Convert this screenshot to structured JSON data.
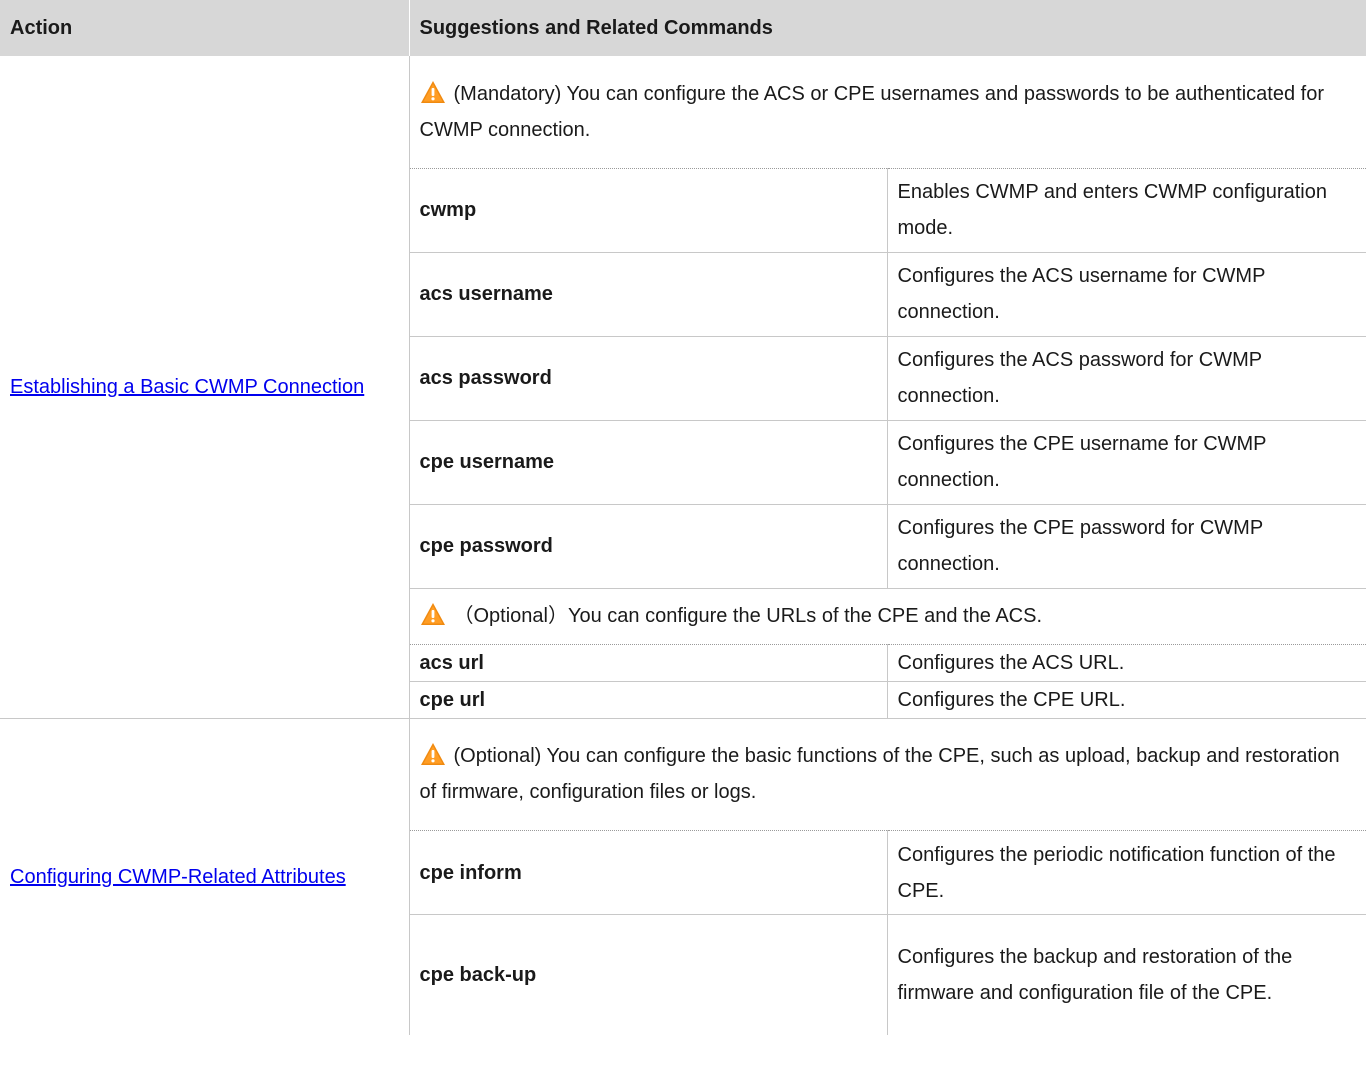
{
  "header": {
    "action": "Action",
    "suggestions": "Suggestions and Related Commands"
  },
  "sections": [
    {
      "action": "Establishing a Basic CWMP Connection",
      "groups": [
        {
          "note": "(Mandatory) You can configure the ACS or CPE usernames and passwords to be authenticated for CWMP connection.",
          "commands": [
            {
              "command": "cwmp",
              "description": "Enables CWMP and enters CWMP configuration mode."
            },
            {
              "command": "acs username",
              "description": "Configures the ACS username for CWMP connection."
            },
            {
              "command": "acs password",
              "description": "Configures the ACS password for CWMP connection."
            },
            {
              "command": "cpe username",
              "description": "Configures the CPE username for CWMP connection."
            },
            {
              "command": "cpe password",
              "description": "Configures the CPE password for CWMP connection."
            }
          ]
        },
        {
          "note": "（Optional）You can configure the URLs of the CPE and the ACS.",
          "commands": [
            {
              "command": "acs url",
              "description": "Configures the ACS URL."
            },
            {
              "command": "cpe url",
              "description": "Configures the CPE URL."
            }
          ]
        }
      ]
    },
    {
      "action": "Configuring CWMP-Related Attributes",
      "groups": [
        {
          "note": "(Optional) You can configure the basic functions of the CPE, such as upload, backup and restoration of firmware, configuration files or logs.",
          "commands": [
            {
              "command": "cpe inform",
              "description": "Configures the periodic notification function of the CPE."
            },
            {
              "command": "cpe back-up",
              "description": "Configures the backup and restoration of the firmware and configuration file of the CPE."
            }
          ]
        }
      ]
    }
  ],
  "icons": {
    "warning": "warning-triangle-icon"
  },
  "colors": {
    "header_bg": "#d7d7d7",
    "link": "#0000ee",
    "warning_orange": "#f08a10"
  }
}
